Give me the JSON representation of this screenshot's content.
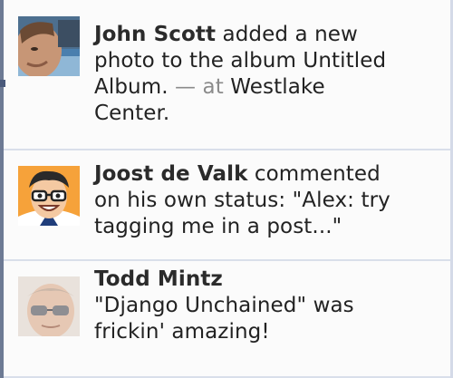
{
  "notifications": [
    {
      "name": "John Scott",
      "lines": [
        "added a new",
        "photo to the album Untitled",
        "Album."
      ],
      "at_sep": "— at",
      "location": "Westlake",
      "location_end": "Center."
    },
    {
      "name": "Joost de Valk",
      "lines": [
        "commented",
        "on his own status: \"Alex: try",
        "tagging me in a post...\""
      ]
    },
    {
      "name": "Todd Mintz",
      "lines": [
        "\"Django Unchained\" was",
        "frickin' amazing!"
      ]
    }
  ]
}
